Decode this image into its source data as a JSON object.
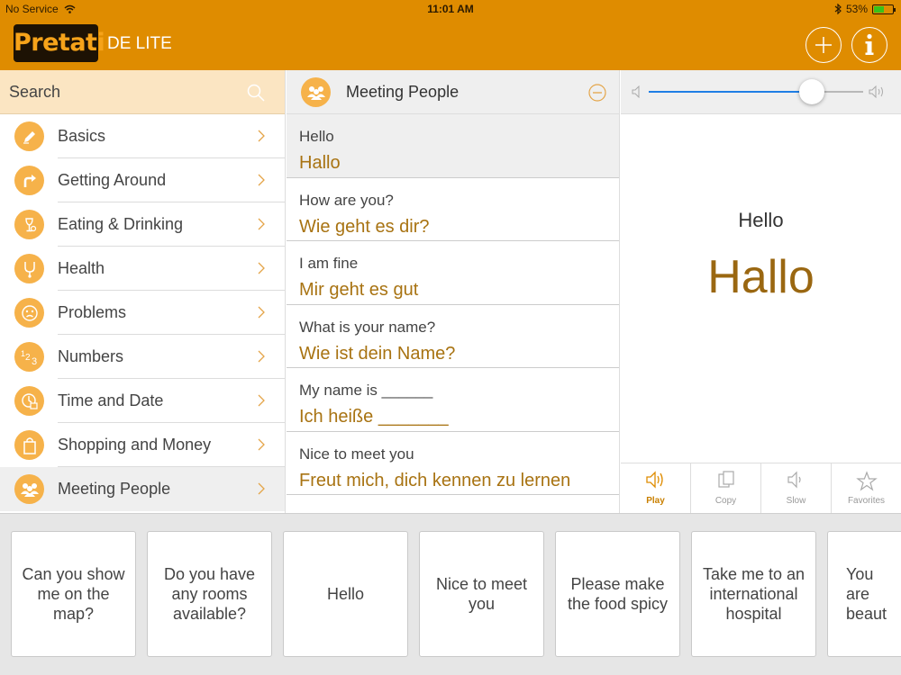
{
  "status_bar": {
    "carrier": "No Service",
    "time": "11:01 AM",
    "battery_text": "53%",
    "battery_level": 0.53,
    "wifi_icon": "wifi-icon",
    "bluetooth_icon": "bluetooth-icon"
  },
  "header": {
    "logo": "Pretati",
    "edition": "DE LITE",
    "add_icon": "plus-circle-icon",
    "info_icon": "info-circle-icon"
  },
  "search": {
    "placeholder": "Search",
    "icon": "search-icon"
  },
  "categories": [
    {
      "label": "Basics",
      "icon": "pencil-icon"
    },
    {
      "label": "Getting Around",
      "icon": "turn-arrow-icon"
    },
    {
      "label": "Eating & Drinking",
      "icon": "wine-glass-icon"
    },
    {
      "label": "Health",
      "icon": "stethoscope-icon"
    },
    {
      "label": "Problems",
      "icon": "sad-face-icon"
    },
    {
      "label": "Numbers",
      "icon": "numbers-icon"
    },
    {
      "label": "Time and Date",
      "icon": "clock-calendar-icon"
    },
    {
      "label": "Shopping and Money",
      "icon": "shopping-bag-icon"
    },
    {
      "label": "Meeting People",
      "icon": "people-icon"
    }
  ],
  "phrase_panel": {
    "title": "Meeting People",
    "icon": "people-icon",
    "collapse_icon": "minus-circle-icon",
    "phrases": [
      {
        "en": "Hello",
        "de": "Hallo"
      },
      {
        "en": "How are you?",
        "de": "Wie geht es dir?"
      },
      {
        "en": "I am fine",
        "de": "Mir geht es gut"
      },
      {
        "en": "What is your name?",
        "de": "Wie ist dein Name?"
      },
      {
        "en": "My name is ______",
        "de": "Ich heiße _______"
      },
      {
        "en": "Nice to meet you",
        "de": "Freut mich, dich kennen zu lernen"
      }
    ]
  },
  "player": {
    "volume": 0.76,
    "volume_low_icon": "speaker-low-icon",
    "volume_high_icon": "speaker-high-icon",
    "current_en": "Hello",
    "current_de": "Hallo",
    "actions": [
      {
        "label": "Play",
        "icon": "speaker-icon"
      },
      {
        "label": "Copy",
        "icon": "copy-icon"
      },
      {
        "label": "Slow",
        "icon": "speaker-slow-icon"
      },
      {
        "label": "Favorites",
        "icon": "star-icon"
      }
    ]
  },
  "recent_cards": [
    "Can you show me on the map?",
    "Do you have any rooms available?",
    "Hello",
    "Nice to meet you",
    "Please make the food spicy",
    "Take me to an international hospital",
    "You are beaut"
  ],
  "colors": {
    "brand_orange": "#df8c00",
    "icon_orange": "#f6b24a",
    "german_text": "#a87312",
    "slider_blue": "#1f7ee5"
  }
}
